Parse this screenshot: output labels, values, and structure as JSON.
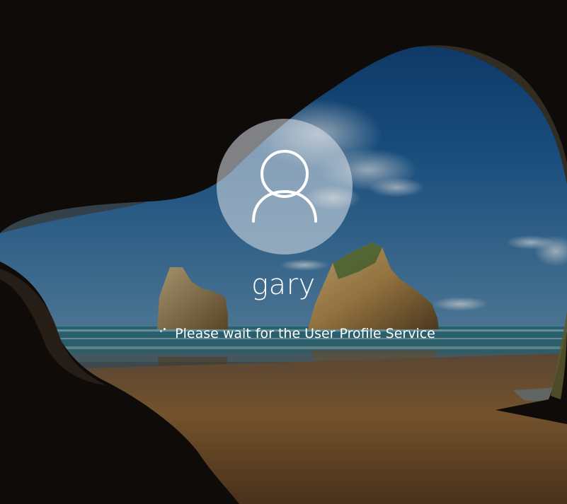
{
  "lock_screen": {
    "username": "gary",
    "status_message": "Please wait for the User Profile Service",
    "avatar_icon": "user-silhouette-icon",
    "spinner_icon": "loading-spinner-icon"
  },
  "colors": {
    "text": "#ffffff",
    "avatar_circle": "#dee4ea",
    "sky": "#1f5e96",
    "sea": "#2c6f86",
    "sand": "#8a6236",
    "cave_rock": "#0f0c0a"
  }
}
